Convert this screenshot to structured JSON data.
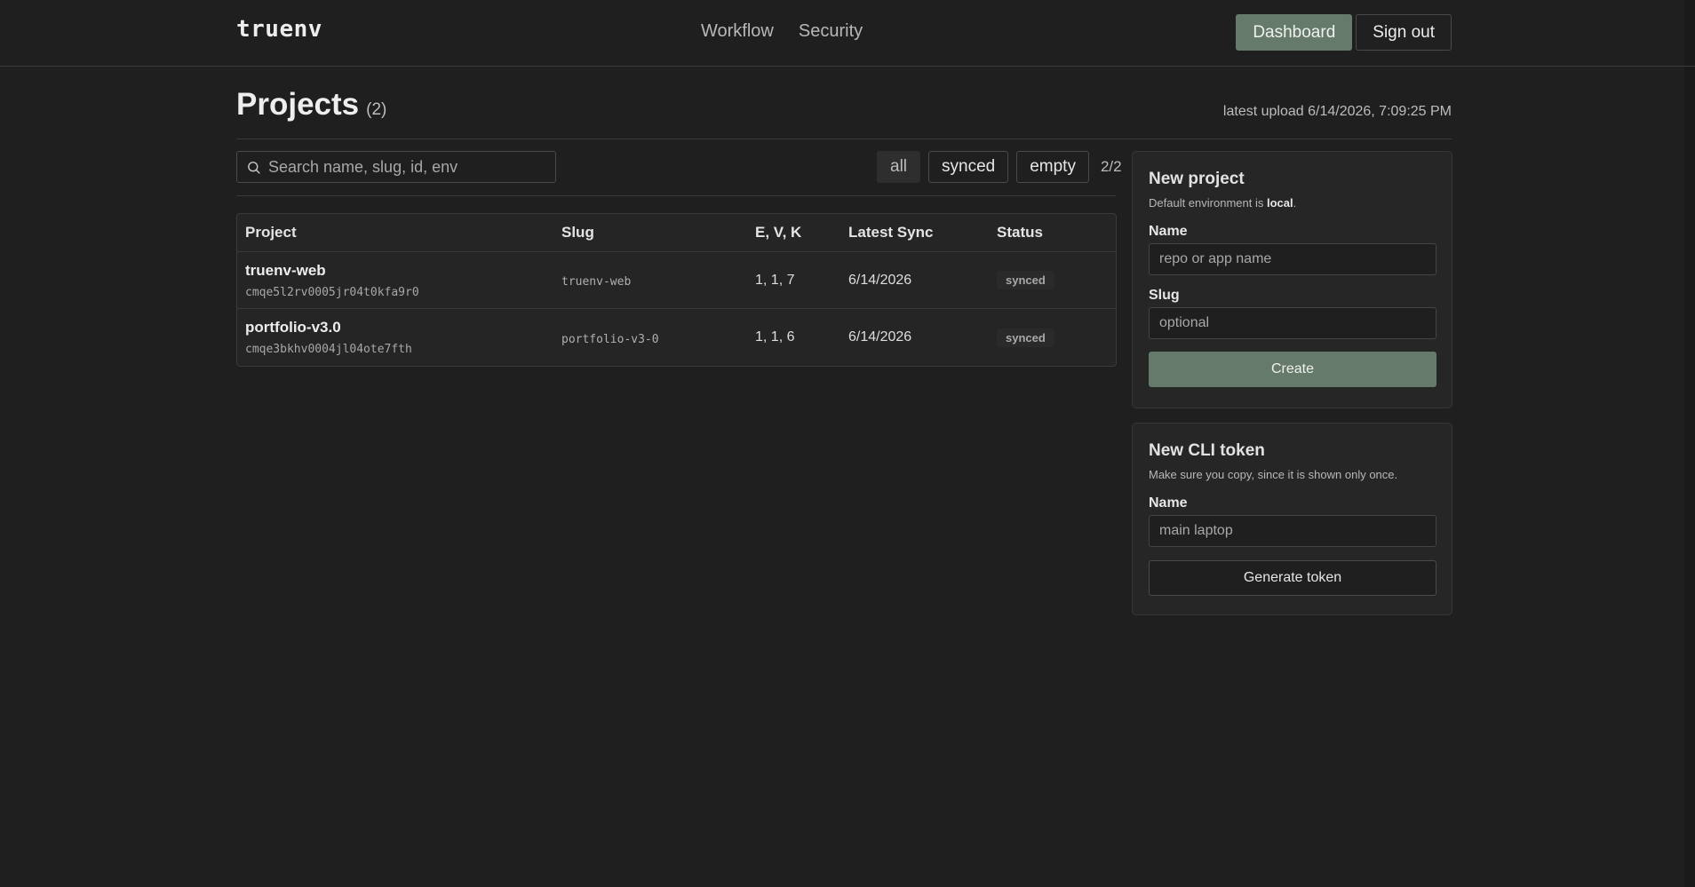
{
  "header": {
    "logo": "truenv",
    "nav": [
      "Workflow",
      "Security"
    ],
    "dashboard_label": "Dashboard",
    "signout_label": "Sign out"
  },
  "projects": {
    "title": "Projects",
    "count": "(2)",
    "latest_upload": "latest upload 6/14/2026, 7:09:25 PM",
    "search_placeholder": "Search name, slug, id, env",
    "filters": [
      "all",
      "synced",
      "empty"
    ],
    "filter_count": "2/2",
    "columns": [
      "Project",
      "Slug",
      "E, V, K",
      "Latest Sync",
      "Status"
    ],
    "rows": [
      {
        "name": "truenv-web",
        "id": "cmqe5l2rv0005jr04t0kfa9r0",
        "slug": "truenv-web",
        "evk": "1, 1, 7",
        "latest_sync": "6/14/2026",
        "status": "synced"
      },
      {
        "name": "portfolio-v3.0",
        "id": "cmqe3bkhv0004jl04ote7fth",
        "slug": "portfolio-v3-0",
        "evk": "1, 1, 6",
        "latest_sync": "6/14/2026",
        "status": "synced"
      }
    ]
  },
  "new_project": {
    "title": "New project",
    "desc_prefix": "Default environment is ",
    "desc_env": "local",
    "desc_suffix": ".",
    "name_label": "Name",
    "name_placeholder": "repo or app name",
    "slug_label": "Slug",
    "slug_placeholder": "optional",
    "create_label": "Create"
  },
  "new_token": {
    "title": "New CLI token",
    "desc": "Make sure you copy, since it is shown only once.",
    "name_label": "Name",
    "name_placeholder": "main laptop",
    "generate_label": "Generate token"
  },
  "colors": {
    "background": "#1f1f1f",
    "accent": "#657a6a",
    "border": "#3a3a3a"
  },
  "icons": {
    "search": "search-icon"
  }
}
